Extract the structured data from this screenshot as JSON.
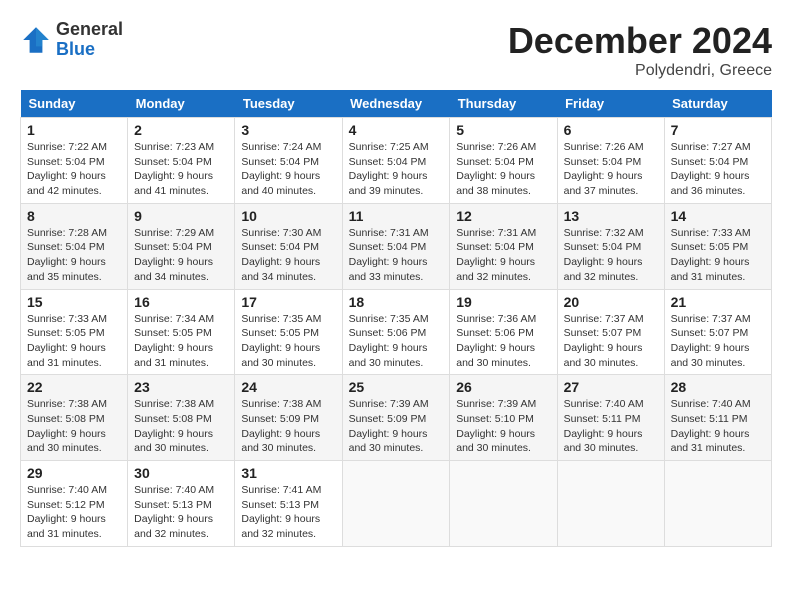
{
  "header": {
    "logo_general": "General",
    "logo_blue": "Blue",
    "month": "December 2024",
    "location": "Polydendri, Greece"
  },
  "days_of_week": [
    "Sunday",
    "Monday",
    "Tuesday",
    "Wednesday",
    "Thursday",
    "Friday",
    "Saturday"
  ],
  "weeks": [
    [
      {
        "day": "1",
        "sunrise": "7:22 AM",
        "sunset": "5:04 PM",
        "daylight": "9 hours and 42 minutes."
      },
      {
        "day": "2",
        "sunrise": "7:23 AM",
        "sunset": "5:04 PM",
        "daylight": "9 hours and 41 minutes."
      },
      {
        "day": "3",
        "sunrise": "7:24 AM",
        "sunset": "5:04 PM",
        "daylight": "9 hours and 40 minutes."
      },
      {
        "day": "4",
        "sunrise": "7:25 AM",
        "sunset": "5:04 PM",
        "daylight": "9 hours and 39 minutes."
      },
      {
        "day": "5",
        "sunrise": "7:26 AM",
        "sunset": "5:04 PM",
        "daylight": "9 hours and 38 minutes."
      },
      {
        "day": "6",
        "sunrise": "7:26 AM",
        "sunset": "5:04 PM",
        "daylight": "9 hours and 37 minutes."
      },
      {
        "day": "7",
        "sunrise": "7:27 AM",
        "sunset": "5:04 PM",
        "daylight": "9 hours and 36 minutes."
      }
    ],
    [
      {
        "day": "8",
        "sunrise": "7:28 AM",
        "sunset": "5:04 PM",
        "daylight": "9 hours and 35 minutes."
      },
      {
        "day": "9",
        "sunrise": "7:29 AM",
        "sunset": "5:04 PM",
        "daylight": "9 hours and 34 minutes."
      },
      {
        "day": "10",
        "sunrise": "7:30 AM",
        "sunset": "5:04 PM",
        "daylight": "9 hours and 34 minutes."
      },
      {
        "day": "11",
        "sunrise": "7:31 AM",
        "sunset": "5:04 PM",
        "daylight": "9 hours and 33 minutes."
      },
      {
        "day": "12",
        "sunrise": "7:31 AM",
        "sunset": "5:04 PM",
        "daylight": "9 hours and 32 minutes."
      },
      {
        "day": "13",
        "sunrise": "7:32 AM",
        "sunset": "5:04 PM",
        "daylight": "9 hours and 32 minutes."
      },
      {
        "day": "14",
        "sunrise": "7:33 AM",
        "sunset": "5:05 PM",
        "daylight": "9 hours and 31 minutes."
      }
    ],
    [
      {
        "day": "15",
        "sunrise": "7:33 AM",
        "sunset": "5:05 PM",
        "daylight": "9 hours and 31 minutes."
      },
      {
        "day": "16",
        "sunrise": "7:34 AM",
        "sunset": "5:05 PM",
        "daylight": "9 hours and 31 minutes."
      },
      {
        "day": "17",
        "sunrise": "7:35 AM",
        "sunset": "5:05 PM",
        "daylight": "9 hours and 30 minutes."
      },
      {
        "day": "18",
        "sunrise": "7:35 AM",
        "sunset": "5:06 PM",
        "daylight": "9 hours and 30 minutes."
      },
      {
        "day": "19",
        "sunrise": "7:36 AM",
        "sunset": "5:06 PM",
        "daylight": "9 hours and 30 minutes."
      },
      {
        "day": "20",
        "sunrise": "7:37 AM",
        "sunset": "5:07 PM",
        "daylight": "9 hours and 30 minutes."
      },
      {
        "day": "21",
        "sunrise": "7:37 AM",
        "sunset": "5:07 PM",
        "daylight": "9 hours and 30 minutes."
      }
    ],
    [
      {
        "day": "22",
        "sunrise": "7:38 AM",
        "sunset": "5:08 PM",
        "daylight": "9 hours and 30 minutes."
      },
      {
        "day": "23",
        "sunrise": "7:38 AM",
        "sunset": "5:08 PM",
        "daylight": "9 hours and 30 minutes."
      },
      {
        "day": "24",
        "sunrise": "7:38 AM",
        "sunset": "5:09 PM",
        "daylight": "9 hours and 30 minutes."
      },
      {
        "day": "25",
        "sunrise": "7:39 AM",
        "sunset": "5:09 PM",
        "daylight": "9 hours and 30 minutes."
      },
      {
        "day": "26",
        "sunrise": "7:39 AM",
        "sunset": "5:10 PM",
        "daylight": "9 hours and 30 minutes."
      },
      {
        "day": "27",
        "sunrise": "7:40 AM",
        "sunset": "5:11 PM",
        "daylight": "9 hours and 30 minutes."
      },
      {
        "day": "28",
        "sunrise": "7:40 AM",
        "sunset": "5:11 PM",
        "daylight": "9 hours and 31 minutes."
      }
    ],
    [
      {
        "day": "29",
        "sunrise": "7:40 AM",
        "sunset": "5:12 PM",
        "daylight": "9 hours and 31 minutes."
      },
      {
        "day": "30",
        "sunrise": "7:40 AM",
        "sunset": "5:13 PM",
        "daylight": "9 hours and 32 minutes."
      },
      {
        "day": "31",
        "sunrise": "7:41 AM",
        "sunset": "5:13 PM",
        "daylight": "9 hours and 32 minutes."
      },
      null,
      null,
      null,
      null
    ]
  ]
}
